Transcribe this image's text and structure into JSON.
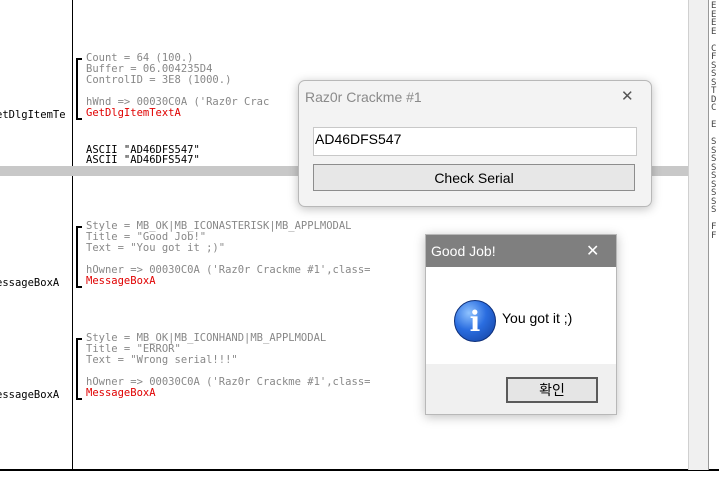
{
  "debugger": {
    "calls": [
      {
        "left_label": "etDlgItemTe",
        "lines": [
          {
            "t": "Count = 64 (100.)",
            "c": "gray"
          },
          {
            "t": "Buffer = 06.004235D4",
            "c": "gray"
          },
          {
            "t": "ControlID = 3E8 (1000.)",
            "c": "gray"
          },
          {
            "t": "",
            "c": "gray"
          },
          {
            "t": "hWnd => 00030C0A ('Raz0r Crac",
            "c": "gray"
          },
          {
            "t": "GetDlgItemTextA",
            "c": "red"
          }
        ]
      },
      {
        "left_label": "essageBoxA",
        "lines": [
          {
            "t": "Style = MB_OK|MB_ICONASTERISK|MB_APPLMODAL",
            "c": "gray"
          },
          {
            "t": "Title = \"Good Job!\"",
            "c": "gray"
          },
          {
            "t": "Text = \"You got it ;)\"",
            "c": "gray"
          },
          {
            "t": "",
            "c": "gray"
          },
          {
            "t": "hOwner => 00030C0A ('Raz0r Crackme #1',class=",
            "c": "gray"
          },
          {
            "t": "MessageBoxA",
            "c": "red"
          }
        ]
      },
      {
        "left_label": "essageBoxA",
        "lines": [
          {
            "t": "Style = MB_OK|MB_ICONHAND|MB_APPLMODAL",
            "c": "gray"
          },
          {
            "t": "Title = \"ERROR\"",
            "c": "gray"
          },
          {
            "t": "Text = \"Wrong serial!!!\"",
            "c": "gray"
          },
          {
            "t": "",
            "c": "gray"
          },
          {
            "t": "hOwner => 00030C0A ('Raz0r Crackme #1',class=",
            "c": "gray"
          },
          {
            "t": "MessageBoxA",
            "c": "red"
          }
        ]
      }
    ],
    "ascii_lines": [
      "ASCII \"AD46DFS547\"",
      "ASCII \"AD46DFS547\""
    ],
    "right_letters": [
      "E",
      "E",
      "E",
      "E",
      "",
      "C",
      "F",
      "S",
      "S",
      "S",
      "T",
      "D",
      "C",
      "",
      "E",
      "",
      "S",
      "S",
      "S",
      "S",
      "S",
      "S",
      "S",
      "S",
      "S",
      "",
      "F",
      "F"
    ]
  },
  "crackme_window": {
    "title": "Raz0r Crackme #1",
    "serial_value": "AD46DFS547",
    "check_button": "Check Serial",
    "close_glyph": "✕"
  },
  "msgbox": {
    "title": "Good Job!",
    "text": "You got it ;)",
    "ok_button": "확인",
    "close_glyph": "✕",
    "icon_glyph": "i"
  }
}
